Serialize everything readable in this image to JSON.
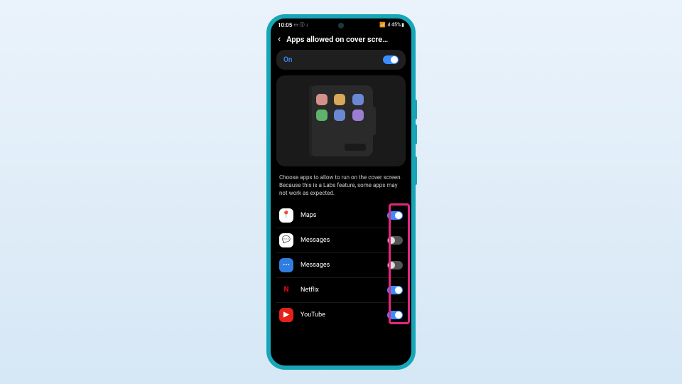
{
  "status_bar": {
    "time": "10:05",
    "left_icons": "▭ ⓘ ↓",
    "right_text": ".ıl 45%",
    "battery_icon": "▮"
  },
  "header": {
    "title": "Apps allowed on cover scre…"
  },
  "master": {
    "label": "On",
    "enabled": true
  },
  "description": "Choose apps to allow to run on the cover screen. Because this is a Labs feature, some apps may not work as expected.",
  "apps": [
    {
      "name": "Maps",
      "icon_bg": "#ffffff",
      "icon_fg": "📍",
      "enabled": true
    },
    {
      "name": "Messages",
      "icon_bg": "#ffffff",
      "icon_fg": "💬",
      "enabled": false
    },
    {
      "name": "Messages",
      "icon_bg": "#2f7de0",
      "icon_fg": "⋯",
      "enabled": false
    },
    {
      "name": "Netflix",
      "icon_bg": "#000000",
      "icon_fg": "N",
      "enabled": true
    },
    {
      "name": "YouTube",
      "icon_bg": "#e62117",
      "icon_fg": "▶",
      "enabled": true
    }
  ],
  "highlight_color": "#e5267e"
}
